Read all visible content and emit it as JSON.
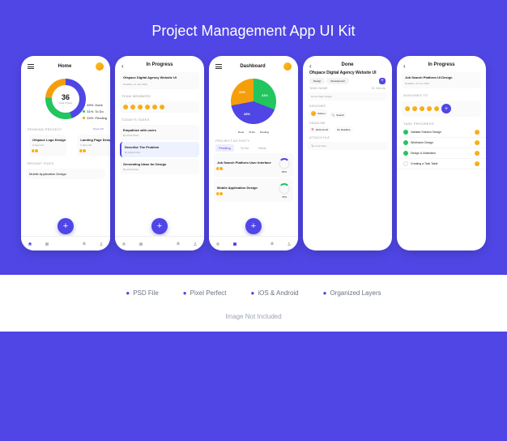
{
  "title": "Project Management App UI Kit",
  "features": [
    "PSD File",
    "Pixel Perfect",
    "iOS & Android",
    "Organized Layers"
  ],
  "disclaimer": "Image Not Included",
  "chart_data": [
    {
      "type": "pie",
      "title": "Home donut",
      "values": [
        45,
        31,
        24
      ],
      "categories": [
        "Done",
        "To Do",
        "Pending"
      ]
    },
    {
      "type": "pie",
      "title": "Dashboard pie",
      "values": [
        31,
        41,
        28
      ],
      "categories": [
        "Done",
        "To Do",
        "Pending"
      ]
    }
  ],
  "s1": {
    "title": "Home",
    "total": "36",
    "total_label": "Total Project",
    "legend": [
      {
        "pct": "45%",
        "lbl": "Done"
      },
      {
        "pct": "31%",
        "lbl": "To Do"
      },
      {
        "pct": "24%",
        "lbl": "Pending"
      }
    ],
    "pending": "PENDING PROJECT",
    "view": "View All",
    "cards": [
      {
        "t": "Ofspace Logo Design",
        "s": "2 days left"
      },
      {
        "t": "Landing Page Design",
        "s": "5 days left"
      }
    ],
    "recent": "RECENT FILES",
    "file": "Mobile Application Design"
  },
  "s2": {
    "title": "In Progress",
    "project": "Ofspace Digital Agency Website UI",
    "deadline": "Deadline: 11 Jan 2022",
    "members": "TEAM MEMBERS",
    "todays": "TODAY'S TASKS",
    "tasks": [
      {
        "t": "Empathize with users",
        "s": "By Ashik Khan"
      },
      {
        "t": "Describe The Problem",
        "s": "By Ashik Khan"
      },
      {
        "t": "Generating Ideas for Design",
        "s": "By Ashik Khan"
      }
    ]
  },
  "s3": {
    "title": "Dashboard",
    "pie": [
      "31%",
      "41%",
      "28%"
    ],
    "legend": [
      "Done",
      "To Do",
      "Pending"
    ],
    "activity": "PROJECT ACTIVITY",
    "tabs": [
      "Pending",
      "To Do",
      "Done"
    ],
    "items": [
      {
        "t": "Job Search Platform User Interface",
        "p": "50%"
      },
      {
        "t": "Mobile Application Design",
        "p": "75%"
      }
    ]
  },
  "s4": {
    "title": "Done",
    "project": "Ofspace Digital Agency Website UI",
    "pills": [
      "Design",
      "Development"
    ],
    "taskname": "TASK NAME",
    "taskval": "Home Page Design",
    "words": "31 Words",
    "assignee": "ASSIGNEE",
    "a1": "Gibson",
    "a2": "Search",
    "deadline": "DEADLINE",
    "d1": "2022-12-24",
    "d2": "No Deadline",
    "attach": "ATTACH FILE",
    "file": "Local Files"
  },
  "s5": {
    "title": "In Progress",
    "project": "Job Search Platform UI Design",
    "deadline": "Deadline: 21 Jan 2022",
    "assigned": "ASSIGNED TO",
    "progress": "TASK PROGRESS",
    "tasks": [
      "Validate Solution Design",
      "Wireframe Design",
      "Design & Illustration",
      "Creating a Task Table"
    ]
  }
}
